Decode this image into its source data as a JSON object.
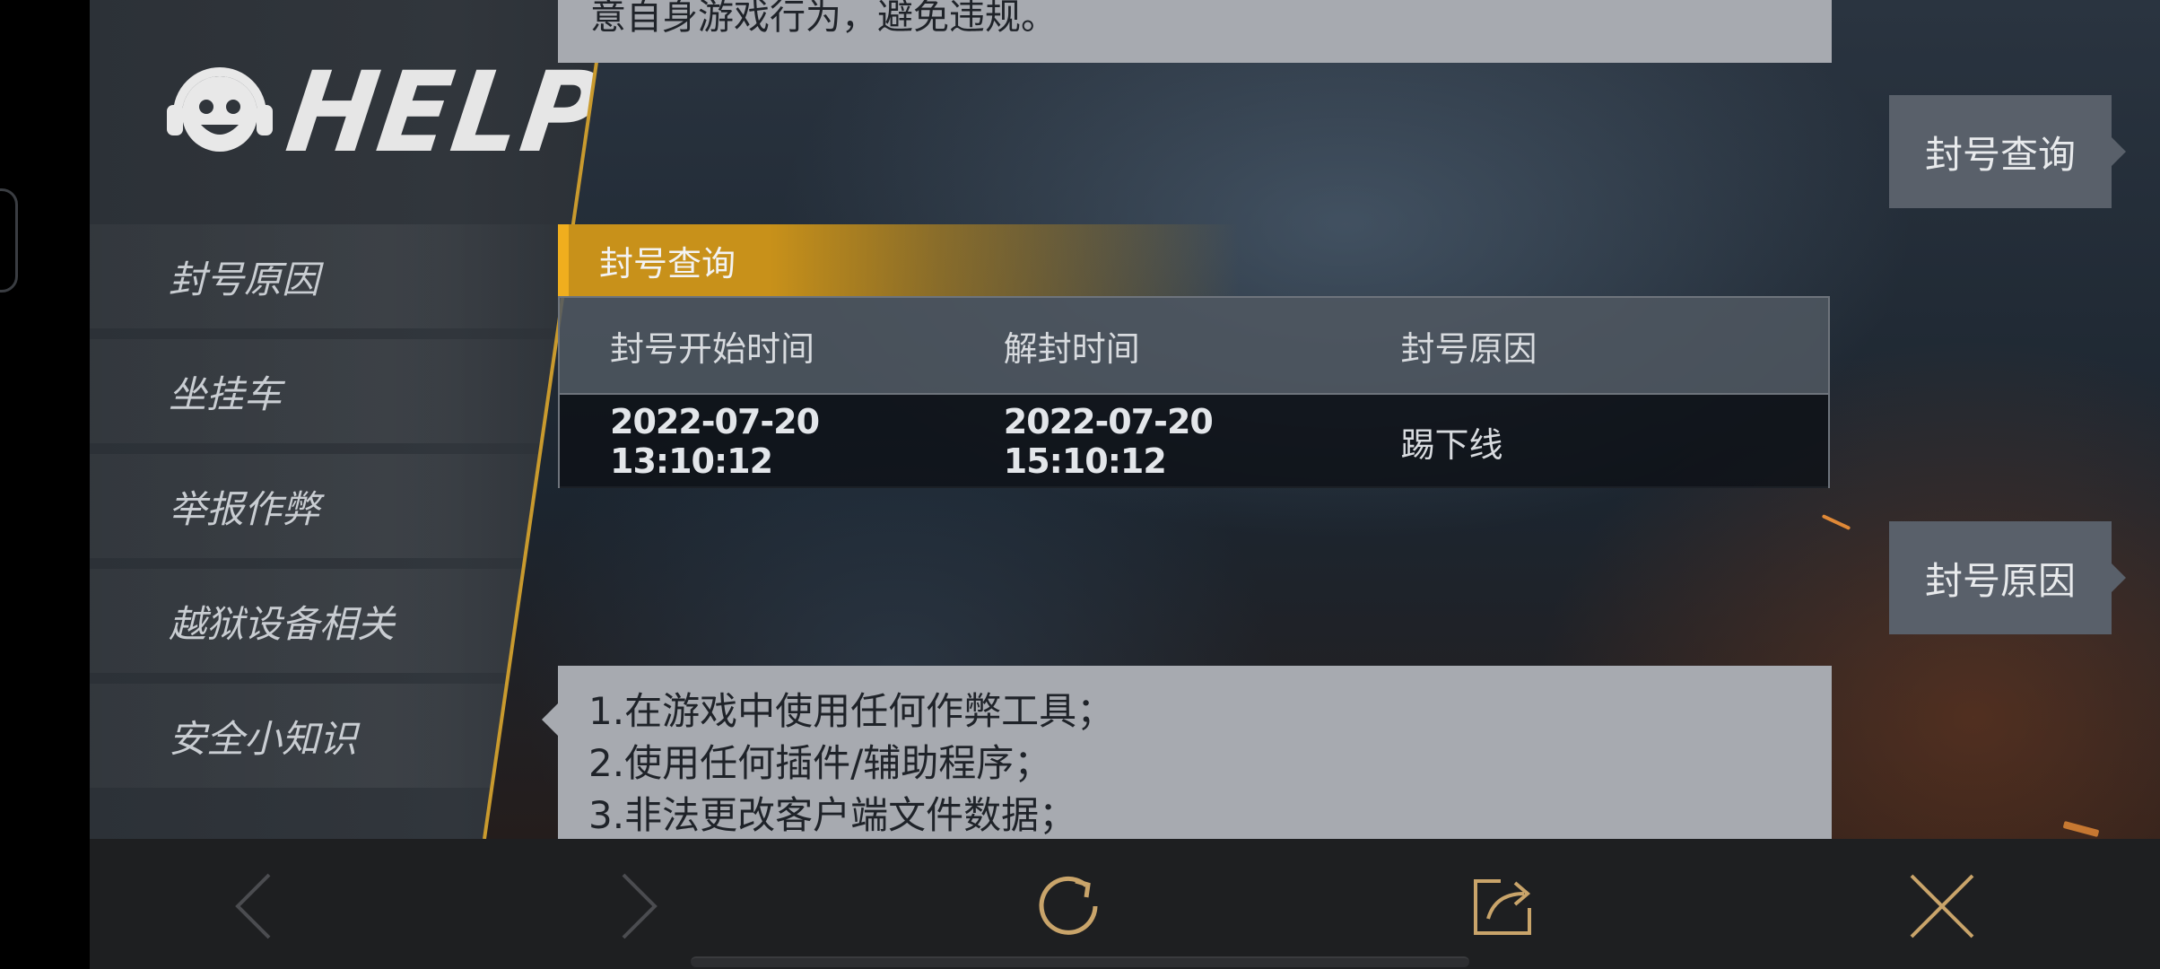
{
  "sidebar": {
    "logo_text": "HELP",
    "items": [
      {
        "label": "封号原因"
      },
      {
        "label": "坐挂车"
      },
      {
        "label": "举报作弊"
      },
      {
        "label": "越狱设备相关"
      },
      {
        "label": "安全小知识"
      }
    ]
  },
  "top_card": {
    "text": "意自身游戏行为，避免违规。"
  },
  "ban_query": {
    "section_title": "封号查询",
    "columns": [
      "封号开始时间",
      "解封时间",
      "封号原因"
    ],
    "rows": [
      [
        "2022-07-20 13:10:12",
        "2022-07-20 15:10:12",
        "踢下线"
      ]
    ]
  },
  "side_tabs": {
    "query_label": "封号查询",
    "reason_label": "封号原因"
  },
  "reasons_card": {
    "lines": [
      "1.在游戏中使用任何作弊工具；",
      "2.使用任何插件/辅助程序；",
      "3.非法更改客户端文件数据；"
    ]
  },
  "navbar": {
    "icons": [
      "back-icon",
      "forward-icon",
      "refresh-icon",
      "share-icon",
      "close-icon"
    ],
    "accent_color": "#c9a46a"
  }
}
